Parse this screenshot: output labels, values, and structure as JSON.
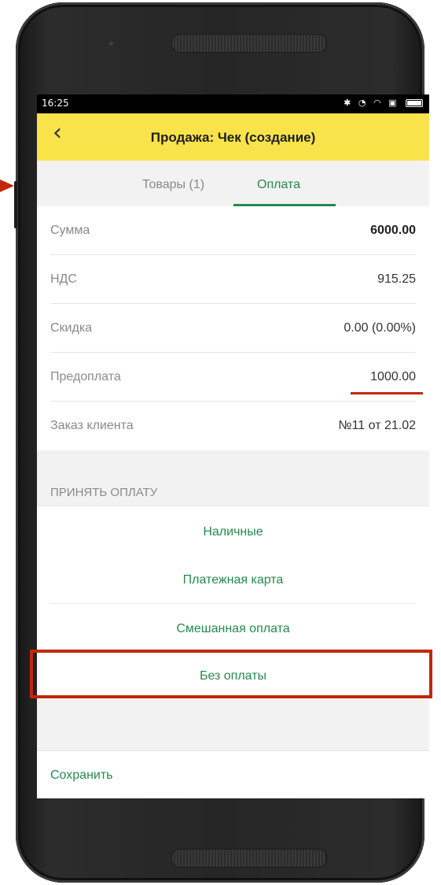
{
  "status_bar": {
    "time": "16:25",
    "icons": [
      "bluetooth-icon",
      "alarm-icon",
      "wifi-icon",
      "sim-icon",
      "battery-icon"
    ]
  },
  "app_bar": {
    "back_icon": "chevron-left-icon",
    "title": "Продажа: Чек (создание)",
    "background_color": "#f9e34a"
  },
  "tabs": [
    {
      "label": "Товары (1)",
      "active": false
    },
    {
      "label": "Оплата",
      "active": true
    }
  ],
  "accent_color": "#27884e",
  "summary": {
    "sum": {
      "label": "Сумма",
      "value": "6000.00"
    },
    "vat": {
      "label": "НДС",
      "value": "915.25"
    },
    "discount": {
      "label": "Скидка",
      "value": "0.00 (0.00%)"
    },
    "prepayment": {
      "label": "Предоплата",
      "value": "1000.00"
    },
    "order": {
      "label": "Заказ клиента",
      "value": "№11 от 21.02"
    }
  },
  "payment": {
    "section_title": "ПРИНЯТЬ ОПЛАТУ",
    "cash": "Наличные",
    "card": "Платежная карта",
    "mixed": "Смешанная оплата",
    "none": "Без оплаты"
  },
  "footer": {
    "save_label": "Сохранить"
  },
  "annotation_color": "#c0280a"
}
